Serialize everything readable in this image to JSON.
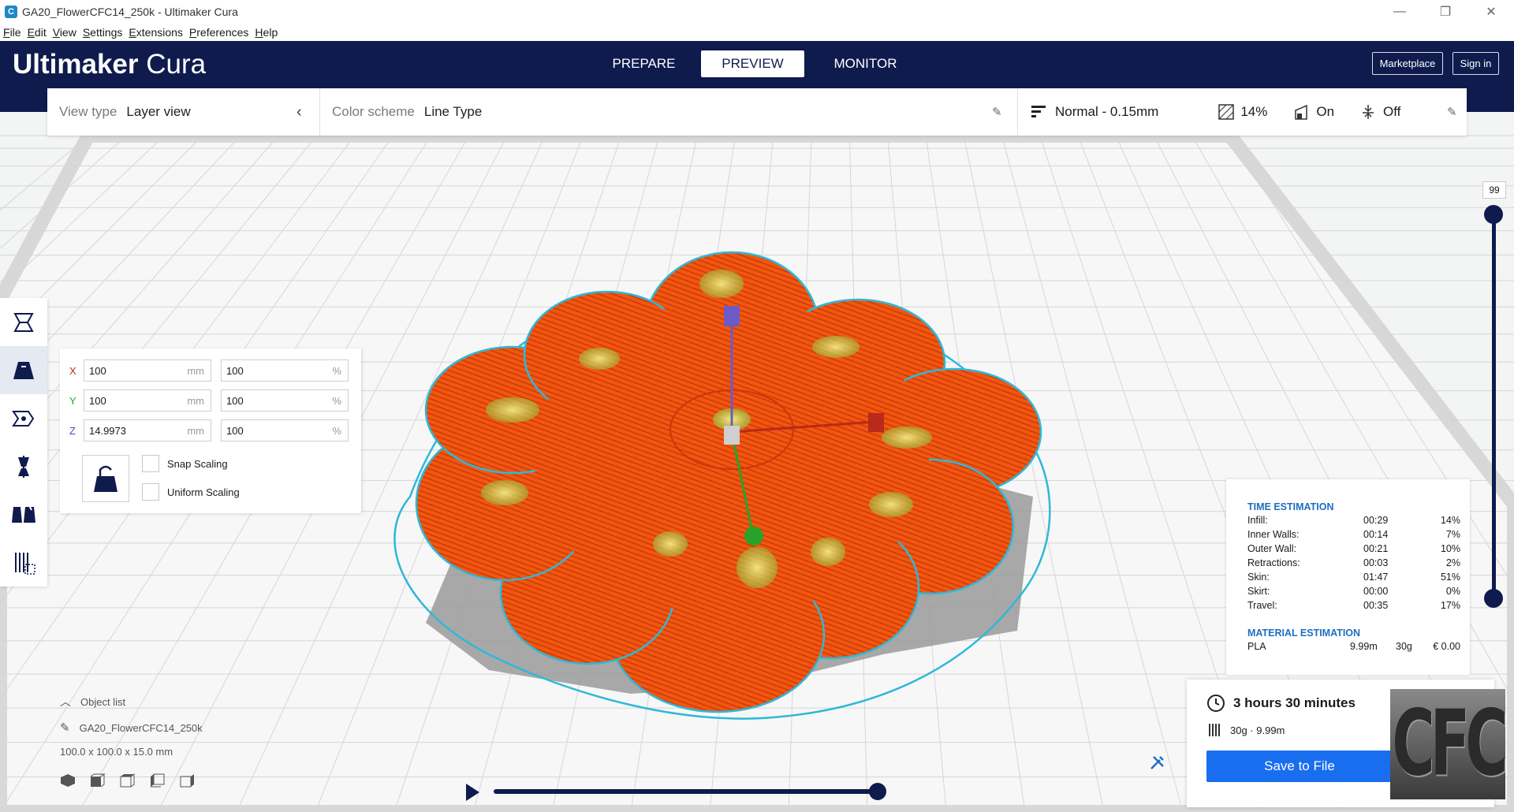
{
  "window": {
    "title": "GA20_FlowerCFC14_250k - Ultimaker Cura",
    "app_icon": "C",
    "controls": [
      "—",
      "❐",
      "✕"
    ]
  },
  "menu": [
    "File",
    "Edit",
    "View",
    "Settings",
    "Extensions",
    "Preferences",
    "Help"
  ],
  "header": {
    "logo_bold": "Ultimaker",
    "logo_light": " Cura",
    "stages": [
      "PREPARE",
      "PREVIEW",
      "MONITOR"
    ],
    "active_stage": "PREVIEW",
    "marketplace": "Marketplace",
    "signin": "Sign in"
  },
  "viewbar": {
    "view_type_label": "View type",
    "view_type_value": "Layer view",
    "color_scheme_label": "Color scheme",
    "color_scheme_value": "Line Type",
    "profile": "Normal - 0.15mm",
    "infill": "14%",
    "support": "On",
    "adhesion": "Off"
  },
  "scale": {
    "x_label": "X",
    "y_label": "Y",
    "z_label": "Z",
    "x_mm": "100",
    "y_mm": "100",
    "z_mm": "14.9973",
    "x_pct": "100",
    "y_pct": "100",
    "z_pct": "100",
    "unit_mm": "mm",
    "unit_pct": "%",
    "snap_label": "Snap Scaling",
    "uniform_label": "Uniform Scaling"
  },
  "objects": {
    "title": "Object list",
    "name": "GA20_FlowerCFC14_250k",
    "dims": "100.0 x 100.0 x 15.0 mm"
  },
  "layer": {
    "current": "99"
  },
  "estimation": {
    "time_title": "TIME ESTIMATION",
    "rows": [
      {
        "name": "Infill:",
        "time": "00:29",
        "pct": "14%"
      },
      {
        "name": "Inner Walls:",
        "time": "00:14",
        "pct": "7%"
      },
      {
        "name": "Outer Wall:",
        "time": "00:21",
        "pct": "10%"
      },
      {
        "name": "Retractions:",
        "time": "00:03",
        "pct": "2%"
      },
      {
        "name": "Skin:",
        "time": "01:47",
        "pct": "51%"
      },
      {
        "name": "Skirt:",
        "time": "00:00",
        "pct": "0%"
      },
      {
        "name": "Travel:",
        "time": "00:35",
        "pct": "17%"
      }
    ],
    "material_title": "MATERIAL ESTIMATION",
    "material": {
      "name": "PLA",
      "length": "9.99m",
      "weight": "30g",
      "cost": "€ 0.00"
    }
  },
  "summary": {
    "time": "3 hours 30 minutes",
    "material": "30g · 9.99m",
    "save": "Save to File"
  },
  "watermark": "CFC",
  "colors": {
    "header": "#0f1b4d",
    "accent": "#196ef0",
    "model": "#f24a0e",
    "skirt": "#2fb8d8",
    "estimate_heading": "#1e6fc0"
  }
}
